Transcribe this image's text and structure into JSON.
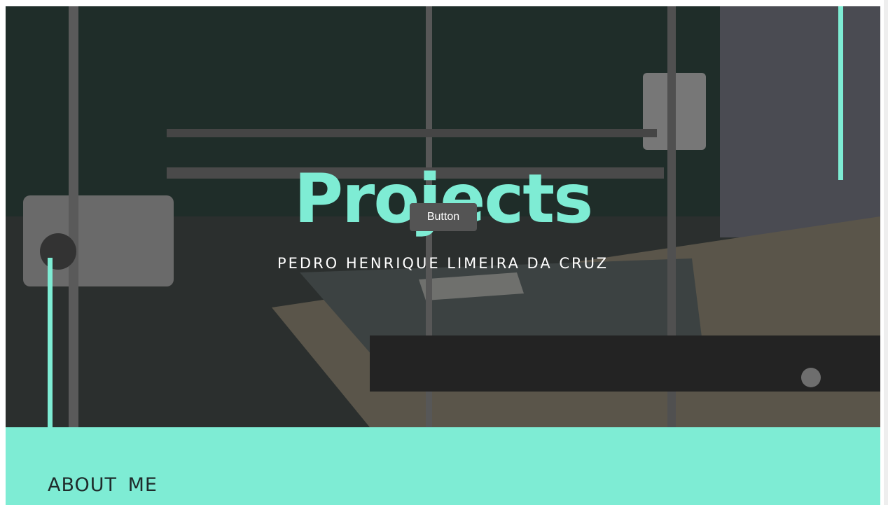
{
  "hero": {
    "title": "Projects",
    "subtitle": "PEDRO HENRIQUE LIMEIRA DA CRUZ",
    "button_label": "Button",
    "background": "3d-printer-photo"
  },
  "about": {
    "heading": "ABOUT ME"
  },
  "colors": {
    "accent": "#7eecd4",
    "overlay": "#2e3131",
    "button": "#545454"
  }
}
